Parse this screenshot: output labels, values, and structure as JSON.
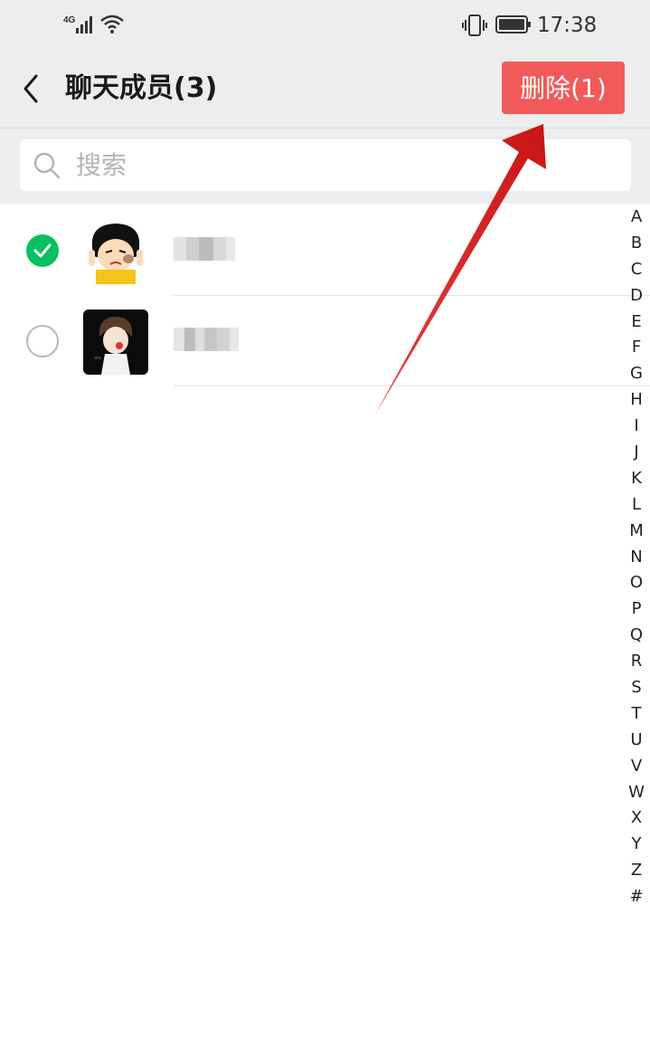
{
  "status_bar": {
    "network": "4G",
    "time": "17:38",
    "icons": [
      "signal-icon",
      "wifi-icon",
      "vibrate-icon",
      "battery-icon"
    ]
  },
  "header": {
    "title": "聊天成员(3)",
    "delete_label": "删除(1)",
    "back_icon": "chevron-left-icon"
  },
  "search": {
    "placeholder": "搜索",
    "value": ""
  },
  "members": [
    {
      "selected": true,
      "avatar": "cartoon-girl-avatar",
      "name": ""
    },
    {
      "selected": false,
      "avatar": "cartoon-boy-avatar",
      "name": ""
    }
  ],
  "index_letters": [
    "A",
    "B",
    "C",
    "D",
    "E",
    "F",
    "G",
    "H",
    "I",
    "J",
    "K",
    "L",
    "M",
    "N",
    "O",
    "P",
    "Q",
    "R",
    "S",
    "T",
    "U",
    "V",
    "W",
    "X",
    "Y",
    "Z",
    "#"
  ],
  "colors": {
    "delete_button": "#f25a5a",
    "check_selected": "#07c160",
    "annotation_arrow": "#e02020",
    "header_bg": "#ededed"
  }
}
